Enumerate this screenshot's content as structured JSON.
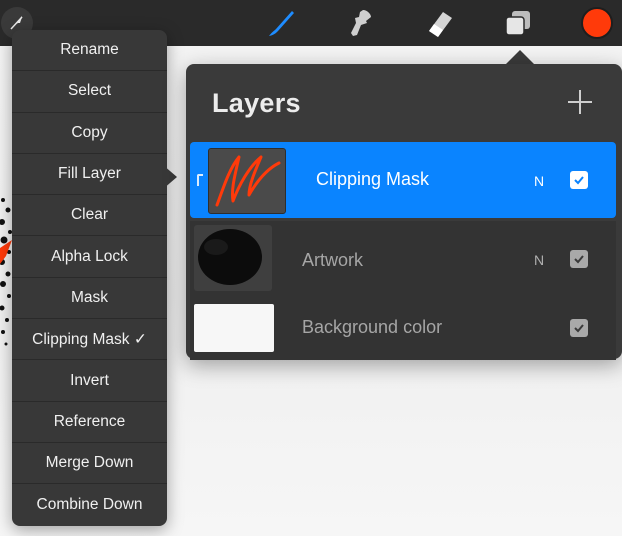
{
  "toolbar": {
    "tools": [
      {
        "icon": "modify-arrow-icon"
      },
      {
        "icon": "brush-icon",
        "color": "#1e8cff"
      },
      {
        "icon": "smudge-icon"
      },
      {
        "icon": "eraser-icon"
      },
      {
        "icon": "layers-icon"
      },
      {
        "icon": "color-swatch",
        "color": "#ff3a0a"
      }
    ]
  },
  "menu": {
    "items": [
      "Rename",
      "Select",
      "Copy",
      "Fill Layer",
      "Clear",
      "Alpha Lock",
      "Mask",
      "Clipping Mask ✓",
      "Invert",
      "Reference",
      "Merge Down",
      "Combine Down"
    ]
  },
  "layers_panel": {
    "title": "Layers",
    "add_icon": "plus-icon",
    "layers": [
      {
        "name": "Clipping Mask",
        "blend": "N",
        "visible": true,
        "selected": true,
        "clipping": true,
        "accent": "#0a84ff"
      },
      {
        "name": "Artwork",
        "blend": "N",
        "visible": true,
        "selected": false
      },
      {
        "name": "Background color",
        "blend": "",
        "visible": true,
        "selected": false
      }
    ]
  }
}
